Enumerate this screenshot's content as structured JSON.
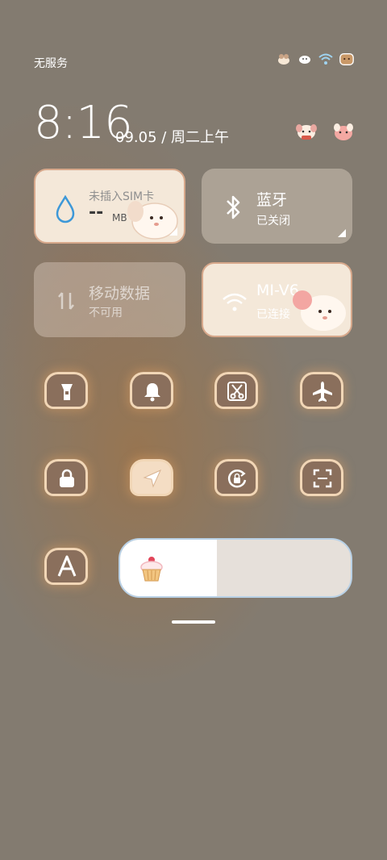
{
  "status_bar": {
    "carrier": "无服务",
    "icons": [
      "dog-icon",
      "dog-icon",
      "wifi-icon",
      "battery-toast-icon"
    ]
  },
  "header": {
    "time": "8:16",
    "date": "09.05 / 周二上午",
    "icons": [
      "dog-face-icon",
      "pig-face-icon"
    ]
  },
  "cards": {
    "data_usage": {
      "title": "未插入SIM卡",
      "value": "--",
      "unit": "MB"
    },
    "bluetooth": {
      "title": "蓝牙",
      "status": "已关闭"
    },
    "mobile_data": {
      "title": "移动数据",
      "status": "不可用"
    },
    "wifi": {
      "title": "MI-V6",
      "status": "已连接"
    }
  },
  "toggles": [
    {
      "name": "flashlight",
      "icon": "flashlight-icon"
    },
    {
      "name": "sound",
      "icon": "bell-icon"
    },
    {
      "name": "screenshot",
      "icon": "scissors-icon"
    },
    {
      "name": "airplane",
      "icon": "airplane-icon"
    },
    {
      "name": "lock",
      "icon": "lock-icon"
    },
    {
      "name": "location",
      "icon": "location-arrow-icon"
    },
    {
      "name": "rotation-lock",
      "icon": "rotation-lock-icon"
    },
    {
      "name": "scanner",
      "icon": "scan-icon"
    },
    {
      "name": "auto-brightness",
      "icon": "letter-a-icon"
    }
  ],
  "brightness": {
    "level": 0.42
  },
  "colors": {
    "accent_cream": "#f4e8d9",
    "accent_border": "#d7a88b",
    "background": "#837b70"
  }
}
